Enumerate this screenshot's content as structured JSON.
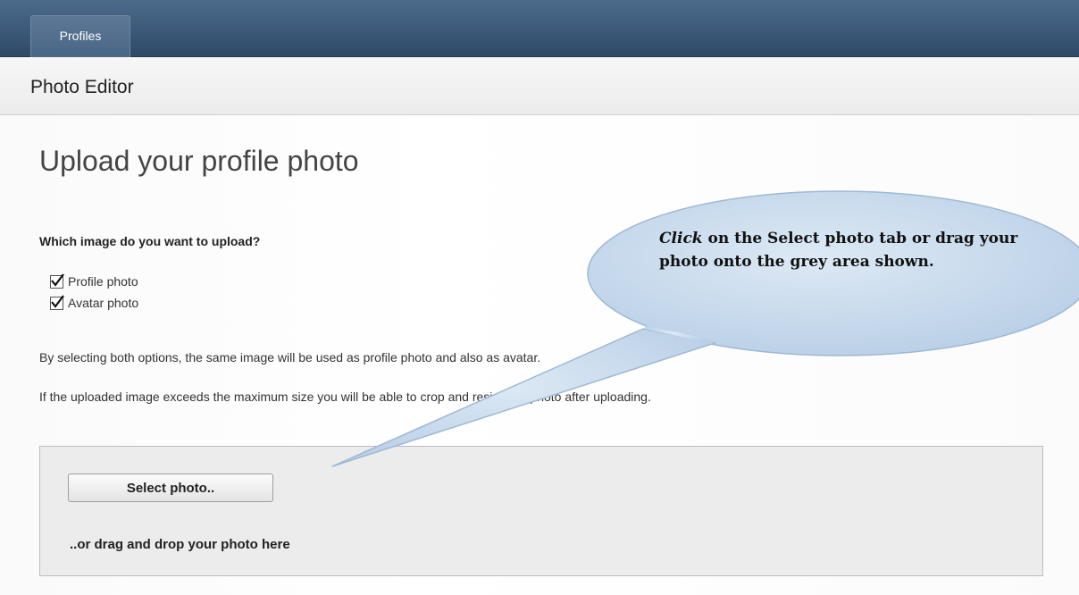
{
  "window_top_text": "... ... ... ... ... ... ... ... ... ...",
  "nav": {
    "tab_label": "Profiles"
  },
  "subheader": {
    "title": "Photo Editor"
  },
  "main": {
    "title": "Upload your profile photo",
    "question": "Which image do you want to upload?",
    "checkboxes": [
      {
        "label": "Profile photo",
        "checked": true
      },
      {
        "label": "Avatar photo",
        "checked": true
      }
    ],
    "para1": "By selecting both options, the same image will be used as profile photo and also as avatar.",
    "para2": "If the uploaded image exceeds the maximum size you will be able to crop and resize the photo after uploading.",
    "dropzone": {
      "button_label": "Select photo..",
      "drop_text": "..or drag and drop your photo here"
    }
  },
  "callout": {
    "emphasis": "Click",
    "text": " on the Select photo tab or drag your photo onto the grey area shown.",
    "fill_color": "#c9dbee"
  },
  "colors": {
    "nav_bar": "#3a5777",
    "dropzone_bg": "#ececec"
  }
}
